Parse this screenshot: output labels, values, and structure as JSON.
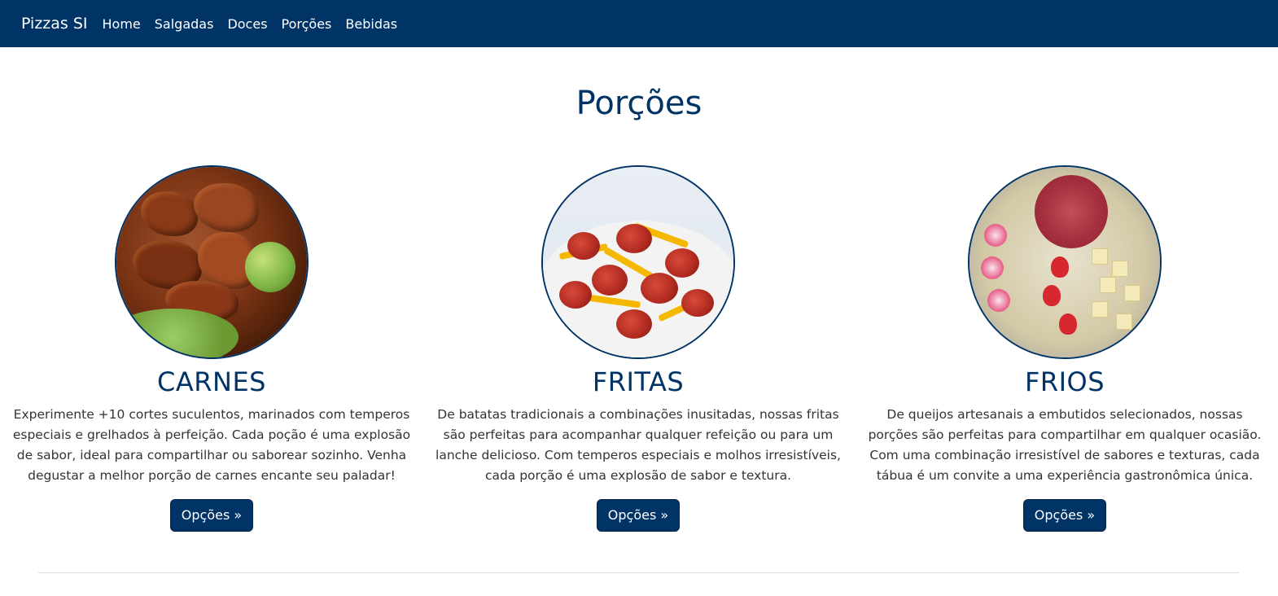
{
  "navbar": {
    "brand": "Pizzas SI",
    "links": [
      "Home",
      "Salgadas",
      "Doces",
      "Porções",
      "Bebidas"
    ],
    "bg_color": "#003366"
  },
  "page": {
    "title": "Porções"
  },
  "cards": [
    {
      "title": "CARNES",
      "text": "Experimente +10 cortes suculentos, marinados com temperos especiais e grelhados à perfeição. Cada poção é uma explosão de sabor, ideal para compartilhar ou saborear sozinho. Venha degustar a melhor porção de carnes encante seu paladar!",
      "button": "Opções »",
      "image_icon": "meat-platter-image"
    },
    {
      "title": "FRITAS",
      "text": "De batatas tradicionais a combinações inusitadas, nossas fritas são perfeitas para acompanhar qualquer refeição ou para um lanche delicioso. Com temperos especiais e molhos irresistíveis, cada porção é uma explosão de sabor e textura.",
      "button": "Opções »",
      "image_icon": "fries-platter-image"
    },
    {
      "title": "FRIOS",
      "text": "De queijos artesanais a embutidos selecionados, nossas porções são perfeitas para compartilhar em qualquer ocasião. Com uma combinação irresistível de sabores e texturas, cada tábua é um convite a uma experiência gastronômica única.",
      "button": "Opções »",
      "image_icon": "cold-cuts-platter-image"
    }
  ],
  "accent_color": "#003366"
}
